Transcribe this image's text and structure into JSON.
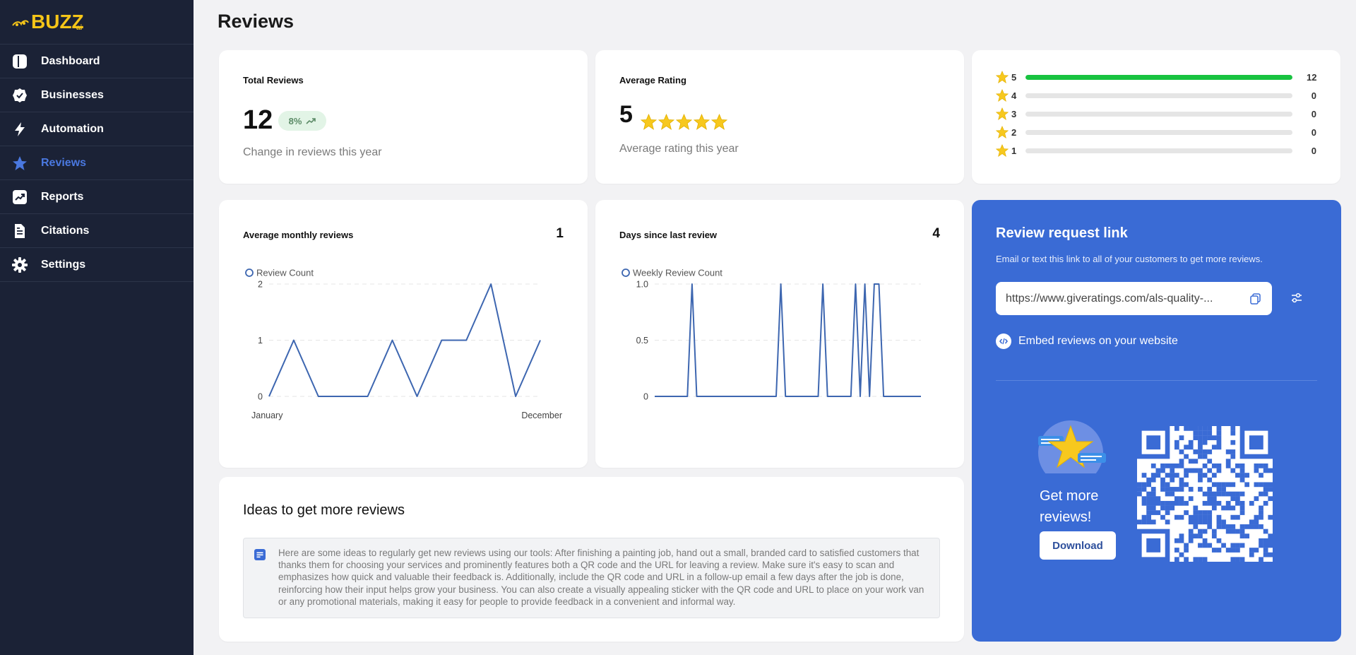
{
  "brand": {
    "logo_text": "BUZZ",
    "logo_suffix": "ai"
  },
  "sidebar": {
    "items": [
      {
        "label": "Dashboard",
        "icon": "dashboard-icon",
        "active": false
      },
      {
        "label": "Businesses",
        "icon": "check-badge-icon",
        "active": false
      },
      {
        "label": "Automation",
        "icon": "lightning-icon",
        "active": false
      },
      {
        "label": "Reviews",
        "icon": "star-icon",
        "active": true
      },
      {
        "label": "Reports",
        "icon": "trend-chart-icon",
        "active": false
      },
      {
        "label": "Citations",
        "icon": "document-icon",
        "active": false
      },
      {
        "label": "Settings",
        "icon": "gear-icon",
        "active": false
      }
    ]
  },
  "page": {
    "title": "Reviews"
  },
  "total_reviews": {
    "title": "Total Reviews",
    "value": "12",
    "change_badge": "8%",
    "subtitle": "Change in reviews this year"
  },
  "average_rating": {
    "title": "Average Rating",
    "value": "5",
    "stars": 5,
    "subtitle": "Average rating this year"
  },
  "rating_distribution": [
    {
      "stars": "5",
      "count": "12",
      "fraction": 1.0
    },
    {
      "stars": "4",
      "count": "0",
      "fraction": 0
    },
    {
      "stars": "3",
      "count": "0",
      "fraction": 0
    },
    {
      "stars": "2",
      "count": "0",
      "fraction": 0
    },
    {
      "stars": "1",
      "count": "0",
      "fraction": 0
    }
  ],
  "avg_monthly": {
    "title": "Average monthly reviews",
    "value": "1"
  },
  "days_since": {
    "title": "Days since last review",
    "value": "4"
  },
  "chart_data": [
    {
      "type": "line",
      "legend": "Review Count",
      "x_tick_labels": [
        "January",
        "December"
      ],
      "y_ticks": [
        "0",
        "1",
        "2"
      ],
      "ylim": [
        0,
        2
      ],
      "grid": true,
      "series": [
        {
          "name": "Review Count",
          "values": [
            0,
            1,
            0,
            0,
            0,
            1,
            0,
            1,
            1,
            2,
            0,
            1
          ]
        }
      ]
    },
    {
      "type": "line",
      "legend": "Weekly Review Count",
      "y_ticks": [
        "0",
        "0.5",
        "1.0"
      ],
      "ylim": [
        0,
        1
      ],
      "grid": true,
      "series": [
        {
          "name": "Weekly Review Count",
          "values": [
            0,
            0,
            0,
            0,
            0,
            0,
            0,
            0,
            1,
            0,
            0,
            0,
            0,
            0,
            0,
            0,
            0,
            0,
            0,
            0,
            0,
            0,
            0,
            0,
            0,
            0,
            0,
            1,
            0,
            0,
            0,
            0,
            0,
            0,
            0,
            0,
            1,
            0,
            0,
            0,
            0,
            0,
            0,
            1,
            0,
            1,
            0,
            1,
            1,
            0,
            0,
            0,
            0,
            0,
            0,
            0,
            0,
            0
          ]
        }
      ]
    }
  ],
  "ideas": {
    "title": "Ideas to get more reviews",
    "icon": "note-icon",
    "text": "Here are some ideas to regularly get new reviews using our tools: After finishing a painting job, hand out a small, branded card to satisfied customers that thanks them for choosing your services and prominently features both a QR code and the URL for leaving a review. Make sure it's easy to scan and emphasizes how quick and valuable their feedback is. Additionally, include the QR code and URL in a follow-up email a few days after the job is done, reinforcing how their input helps grow your business. You can also create a visually appealing sticker with the QR code and URL to place on your work van or any promotional materials, making it easy for people to provide feedback in a convenient and informal way."
  },
  "review_request": {
    "title": "Review request link",
    "description": "Email or text this link to all of your customers to get more reviews.",
    "url": "https://www.giveratings.com/als-quality-...",
    "embed_label": "Embed reviews on your website",
    "promo_text": "Get more reviews!",
    "download_label": "Download"
  },
  "colors": {
    "sidebar_bg": "#1b2236",
    "active_nav": "#4a78e0",
    "accent_blue": "#3a6bd5",
    "bar_green": "#18c340",
    "star_yellow": "#f7c81e",
    "line_blue": "#3d66b0"
  }
}
